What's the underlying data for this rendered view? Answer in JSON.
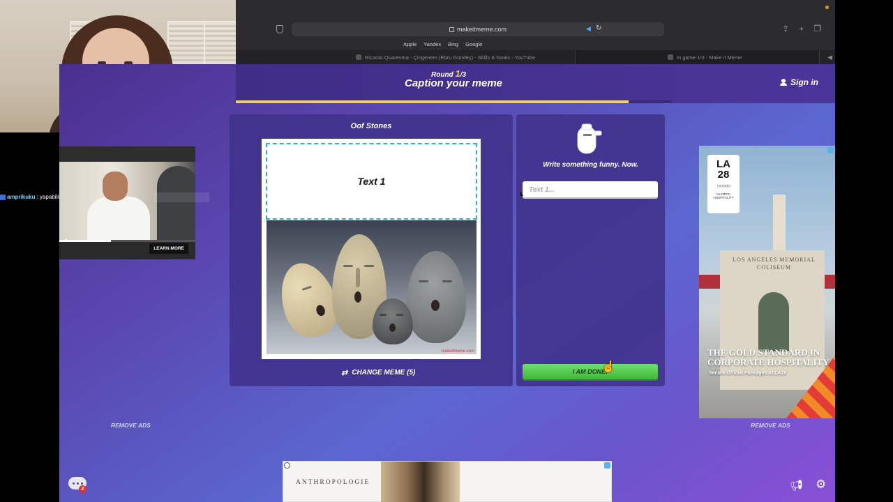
{
  "browser": {
    "url": "makeitmeme.com",
    "favorites": [
      "Apple",
      "Yandex",
      "Bing",
      "Google"
    ],
    "tabs": [
      {
        "label": "Ricardo Quaresma - Çingenem (Ebru Gündeş) - Skills & Goals - YouTube"
      },
      {
        "label": "In game 1/3 - Make it Meme"
      }
    ]
  },
  "chat": {
    "username": "amprikuku",
    "message": ": yapabilirsin"
  },
  "header": {
    "round_prefix": "Round",
    "round_current": "1",
    "round_total": "/3",
    "title": "Caption your meme",
    "signin_label": "Sign in",
    "progress": 0.9
  },
  "meme": {
    "name": "Oof Stones",
    "text_zone_label": "Text 1",
    "watermark": "makeitmeme.com",
    "change_label": "CHANGE MEME (5)"
  },
  "caption": {
    "prompt": "Write something funny. Now.",
    "input_placeholder": "Text 1...",
    "input_value": "",
    "done_label": "I AM DONE!"
  },
  "ads": {
    "left": {
      "learn_more": "LEARN MORE",
      "remove_ads": "REMOVE ADS"
    },
    "right": {
      "logo_text": "LA 28",
      "logo_sub": "OLYMPIC HOSPITALITY",
      "sign": "LOS ANGELES MEMORIAL COLISEUM",
      "headline": "THE GOLD STANDARD IN CORPORATE HOSPITALITY",
      "sub": "Secure Official Packages At LA28",
      "remove_ads": "REMOVE ADS"
    },
    "bottom": {
      "brand": "ANTHROPOLOGIE"
    }
  },
  "footer": {
    "chat_badge_count": "2"
  },
  "icons": [
    "shield-icon",
    "lock-icon",
    "speaker-icon",
    "reload-icon",
    "share-icon",
    "new-tab-icon",
    "tabs-icon",
    "person-icon",
    "shuffle-icon",
    "mascot-icon",
    "mute-icon",
    "chat-icon",
    "megaphone-icon",
    "gear-icon"
  ],
  "colors": {
    "accent": "#f0d060",
    "done_button": "#4fcb4a",
    "dashed_border": "#2ab0d8",
    "page_bg": "#5b67d0"
  }
}
